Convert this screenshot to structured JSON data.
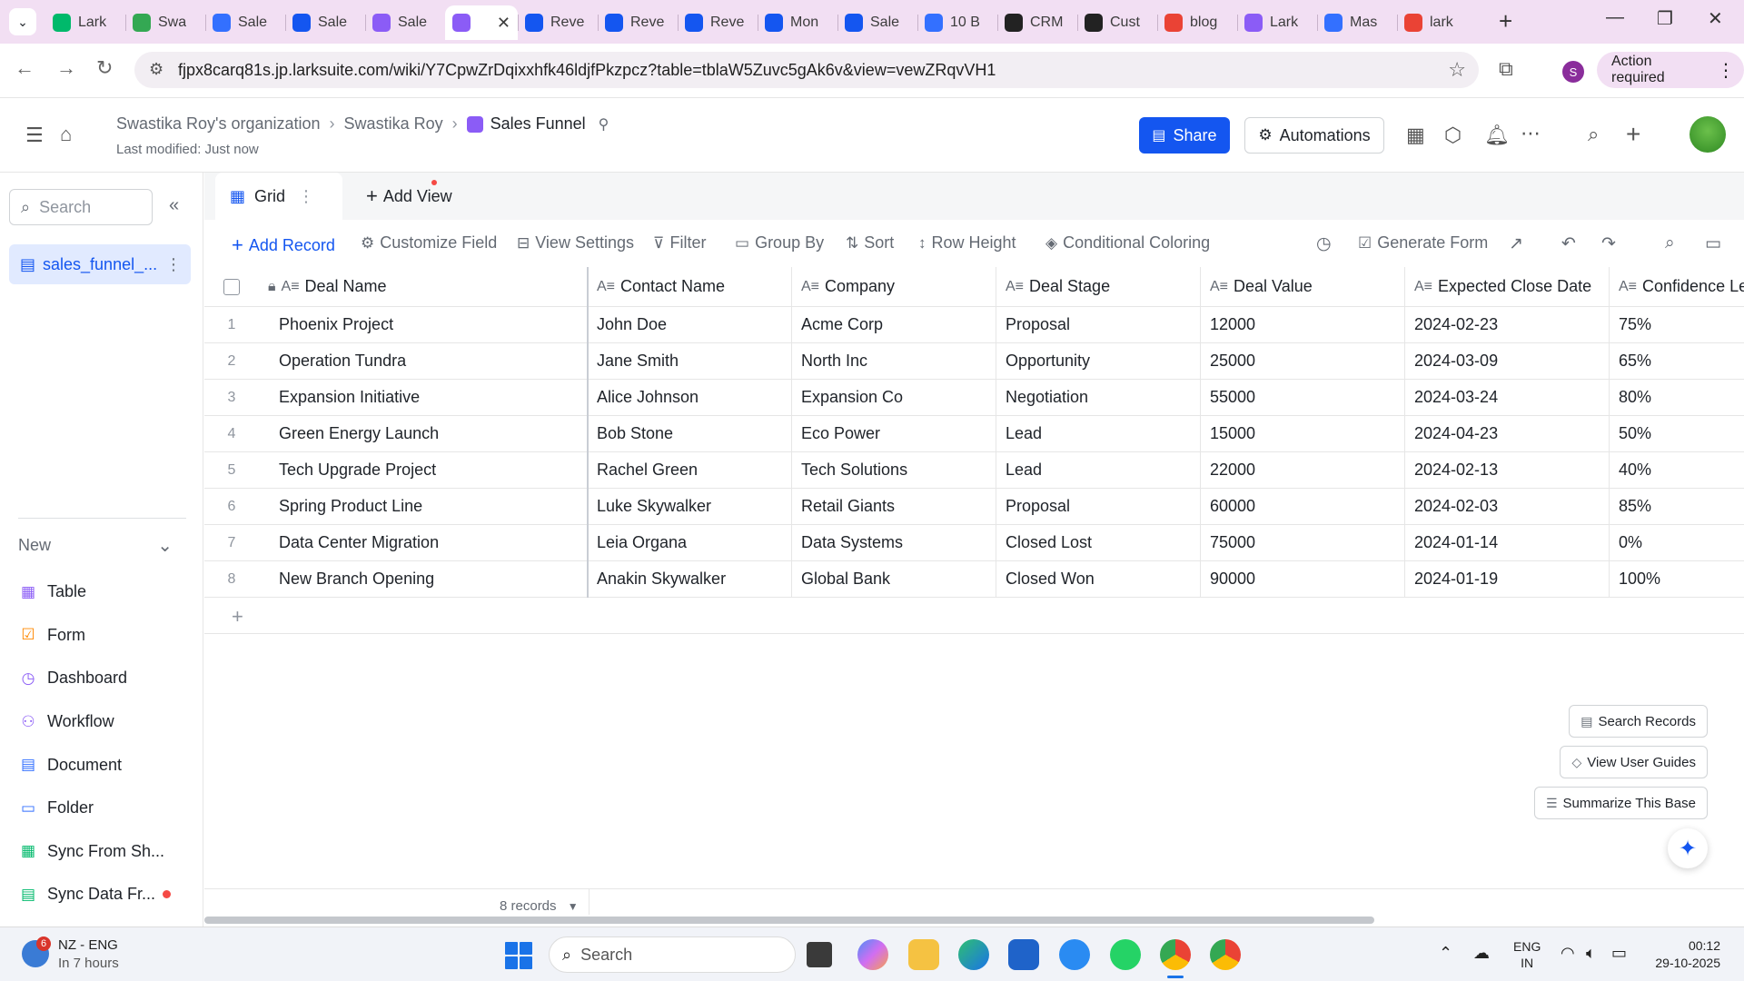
{
  "browser": {
    "tabs": [
      {
        "label": "Lark",
        "color": "#00b96b"
      },
      {
        "label": "Swa",
        "color": "#34a853"
      },
      {
        "label": "Sale",
        "color": "#3370ff"
      },
      {
        "label": "Sale",
        "color": "#1456f0"
      },
      {
        "label": "Sale",
        "color": "#8b5cf6"
      },
      {
        "label": "",
        "color": "#8b5cf6",
        "active": true
      },
      {
        "label": "Reve",
        "color": "#1456f0"
      },
      {
        "label": "Reve",
        "color": "#1456f0"
      },
      {
        "label": "Reve",
        "color": "#1456f0"
      },
      {
        "label": "Mon",
        "color": "#1456f0"
      },
      {
        "label": "Sale",
        "color": "#1456f0"
      },
      {
        "label": "10 B",
        "color": "#3370ff"
      },
      {
        "label": "CRM",
        "color": "#222222"
      },
      {
        "label": "Cust",
        "color": "#222222"
      },
      {
        "label": "blog",
        "color": "#ea4335"
      },
      {
        "label": "Lark",
        "color": "#8b5cf6"
      },
      {
        "label": "Mas",
        "color": "#3370ff"
      },
      {
        "label": "lark",
        "color": "#ea4335"
      }
    ],
    "url": "fjpx8carq81s.jp.larksuite.com/wiki/Y7CpwZrDqixxhfk46ldjfPkzpcz?table=tblaW5Zuvc5gAk6v&view=vewZRqvVH1",
    "profile_initial": "S",
    "action_required": "Action required"
  },
  "header": {
    "breadcrumbs": [
      "Swastika Roy's organization",
      "Swastika Roy"
    ],
    "title": "Sales Funnel",
    "last_modified": "Last modified: Just now",
    "share": "Share",
    "automations": "Automations"
  },
  "sidebar": {
    "search_placeholder": "Search",
    "table_name": "sales_funnel_...",
    "new_label": "New",
    "items": [
      {
        "label": "Table",
        "icon": "table-icon",
        "color": "#8b5cf6"
      },
      {
        "label": "Form",
        "icon": "form-icon",
        "color": "#ff8800"
      },
      {
        "label": "Dashboard",
        "icon": "dashboard-icon",
        "color": "#8b5cf6"
      },
      {
        "label": "Workflow",
        "icon": "workflow-icon",
        "color": "#8b5cf6"
      },
      {
        "label": "Document",
        "icon": "document-icon",
        "color": "#3370ff"
      },
      {
        "label": "Folder",
        "icon": "folder-icon",
        "color": "#3370ff"
      },
      {
        "label": "Sync From Sh...",
        "icon": "sync-sheet-icon",
        "color": "#00b96b"
      },
      {
        "label": "Sync Data Fr...",
        "icon": "sync-data-icon",
        "color": "#00b96b"
      }
    ]
  },
  "views": {
    "grid": "Grid",
    "add_view": "Add View"
  },
  "toolbar": {
    "add_record": "Add Record",
    "customize_field": "Customize Field",
    "view_settings": "View Settings",
    "filter": "Filter",
    "group_by": "Group By",
    "sort": "Sort",
    "row_height": "Row Height",
    "conditional_coloring": "Conditional Coloring",
    "generate_form": "Generate Form"
  },
  "table": {
    "columns": [
      "Deal Name",
      "Contact Name",
      "Company",
      "Deal Stage",
      "Deal Value",
      "Expected Close Date",
      "Confidence Lev"
    ],
    "rows": [
      [
        "1",
        "Phoenix Project",
        "John Doe",
        "Acme Corp",
        "Proposal",
        "12000",
        "2024-02-23",
        "75%"
      ],
      [
        "2",
        "Operation Tundra",
        "Jane Smith",
        "North Inc",
        "Opportunity",
        "25000",
        "2024-03-09",
        "65%"
      ],
      [
        "3",
        "Expansion Initiative",
        "Alice Johnson",
        "Expansion Co",
        "Negotiation",
        "55000",
        "2024-03-24",
        "80%"
      ],
      [
        "4",
        "Green Energy Launch",
        "Bob Stone",
        "Eco Power",
        "Lead",
        "15000",
        "2024-04-23",
        "50%"
      ],
      [
        "5",
        "Tech Upgrade Project",
        "Rachel Green",
        "Tech Solutions",
        "Lead",
        "22000",
        "2024-02-13",
        "40%"
      ],
      [
        "6",
        "Spring Product Line",
        "Luke Skywalker",
        "Retail Giants",
        "Proposal",
        "60000",
        "2024-02-03",
        "85%"
      ],
      [
        "7",
        "Data Center Migration",
        "Leia Organa",
        "Data Systems",
        "Closed Lost",
        "75000",
        "2024-01-14",
        "0%"
      ],
      [
        "8",
        "New Branch Opening",
        "Anakin Skywalker",
        "Global Bank",
        "Closed Won",
        "90000",
        "2024-01-19",
        "100%"
      ]
    ],
    "record_count": "8 records"
  },
  "floating": {
    "search_records": "Search Records",
    "view_user_guides": "View User Guides",
    "summarize": "Summarize This Base"
  },
  "taskbar": {
    "weather_badge": "6",
    "weather_line1": "NZ - ENG",
    "weather_line2": "In 7 hours",
    "search": "Search",
    "lang1": "ENG",
    "lang2": "IN",
    "time": "00:12",
    "date": "29-10-2025"
  }
}
